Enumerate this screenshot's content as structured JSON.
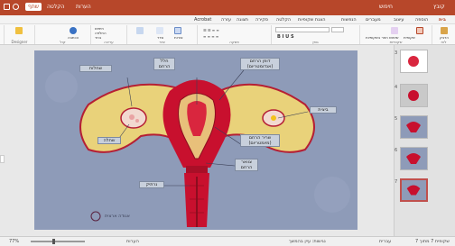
{
  "titlebar": {
    "file": "קובץ",
    "search": "חיפוש",
    "share": "שתף",
    "comments": "הערות",
    "record": "הקלטה"
  },
  "tabs": [
    "בית",
    "הוספה",
    "עיצוב",
    "מעברים",
    "הנפשות",
    "הצגת שקופיות",
    "הקלטה",
    "סקירה",
    "תצוגה",
    "עזרה",
    "Acrobat"
  ],
  "ribbon": {
    "paste": "הדבק",
    "clipboard": "לוח",
    "new_slide": "שקופית חדשה",
    "reuse": "שימוש חוזר בשקופיות",
    "slides": "שקופיות",
    "font": "גופן",
    "paragraph": "פסקה",
    "shapes": "צורות",
    "arrange": "סדר",
    "quick_styles": "סגנונות מהירים",
    "drawing": "ציור",
    "find": "חיפוש",
    "replace": "החלפה",
    "select": "בחר",
    "editing": "עריכה",
    "dictate": "הכתבה",
    "voice": "קול",
    "designer": "Designer",
    "new_slide_btn": "שקופית"
  },
  "slide": {
    "labels": {
      "ovary": "שחלה",
      "ovaries": "שחלות",
      "fundus": "ביצית",
      "uterine_wall_1": "דופן הרחם",
      "uterine_wall_2": "(אנדומטריום)",
      "uterine_muscle_1": "שריר הרחם",
      "uterine_muscle_2": "(מיומטריום)",
      "cervix_1": "צוואר",
      "cervix_2": "הרחם",
      "cavity_1": "חלל",
      "cavity_2": "הרחם",
      "vagina": "נרתיק"
    },
    "credit": "אגודה ארצית"
  },
  "thumbs": [
    "3",
    "4",
    "5",
    "6",
    "7"
  ],
  "status": {
    "slide": "שקופית 7 מתוך 7",
    "lang": "עברית",
    "notes": "הערות",
    "zoom": "77%",
    "accessibility": "נגישות: עיין בהמשך"
  },
  "colors": {
    "accent": "#b7472a",
    "slide_bg": "#8e9bb8",
    "organ": "#c8102e"
  }
}
